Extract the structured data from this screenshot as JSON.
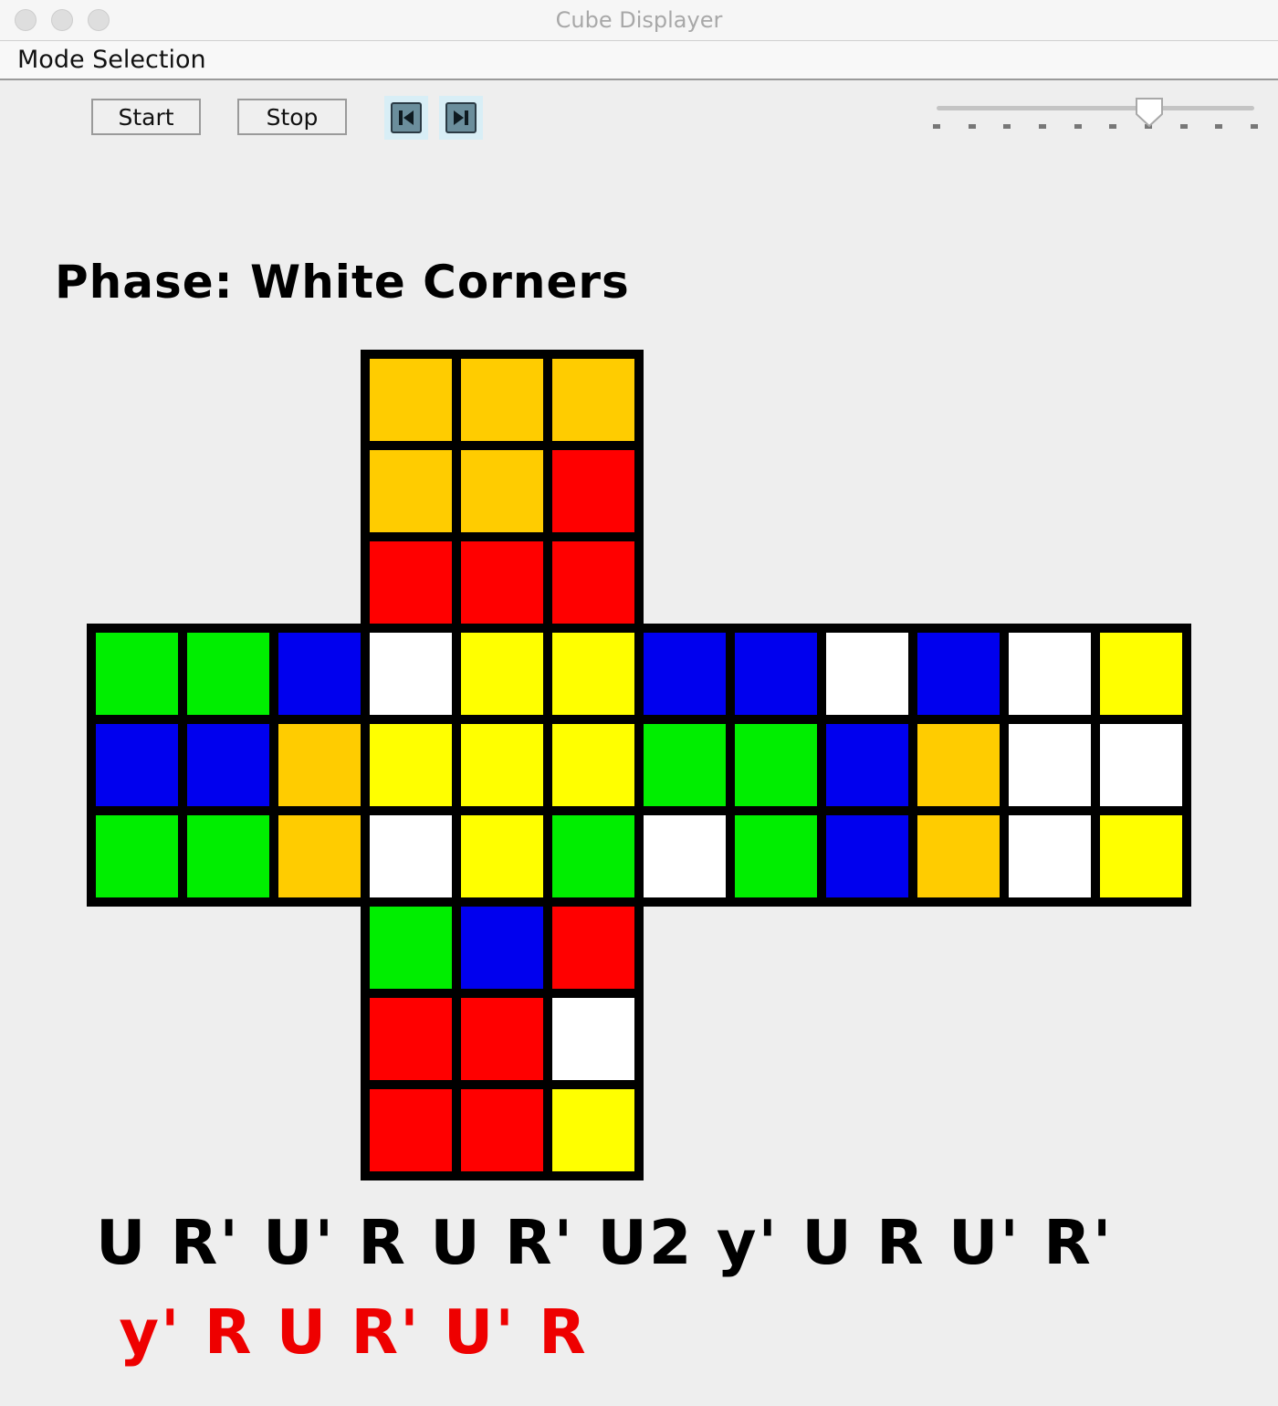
{
  "window": {
    "title": "Cube Displayer"
  },
  "menu": {
    "mode_selection": "Mode Selection"
  },
  "toolbar": {
    "start_label": "Start",
    "stop_label": "Stop",
    "step_back_icon": "skip-back-icon",
    "step_forward_icon": "skip-forward-icon",
    "speed_slider_value": 0.67,
    "speed_slider_tick_count": 10
  },
  "phase": {
    "text": "Phase: White Corners"
  },
  "colors": {
    "O": "#ffcc00",
    "R": "#ff0000",
    "G": "#00ee00",
    "B": "#0000ee",
    "W": "#ffffff",
    "Y": "#ffff00",
    "border": "#000000"
  },
  "cube": {
    "top": [
      [
        "O",
        "O",
        "O"
      ],
      [
        "O",
        "O",
        "R"
      ],
      [
        "R",
        "R",
        "R"
      ]
    ],
    "left": [
      [
        "G",
        "G",
        "B"
      ],
      [
        "B",
        "B",
        "O"
      ],
      [
        "G",
        "G",
        "O"
      ]
    ],
    "front": [
      [
        "W",
        "Y",
        "Y"
      ],
      [
        "Y",
        "Y",
        "Y"
      ],
      [
        "W",
        "Y",
        "G"
      ]
    ],
    "right": [
      [
        "B",
        "B",
        "W"
      ],
      [
        "G",
        "G",
        "B"
      ],
      [
        "W",
        "G",
        "B"
      ]
    ],
    "back": [
      [
        "B",
        "W",
        "Y"
      ],
      [
        "O",
        "W",
        "W"
      ],
      [
        "O",
        "W",
        "Y"
      ]
    ],
    "bottom": [
      [
        "G",
        "B",
        "R"
      ],
      [
        "R",
        "R",
        "W"
      ],
      [
        "R",
        "R",
        "Y"
      ]
    ]
  },
  "moves": {
    "done": "U R' U' R U R' U2 y' U R U' R'",
    "pending": " y' R U R' U' R",
    "done_color": "#000000",
    "pending_color": "#ee0000"
  }
}
